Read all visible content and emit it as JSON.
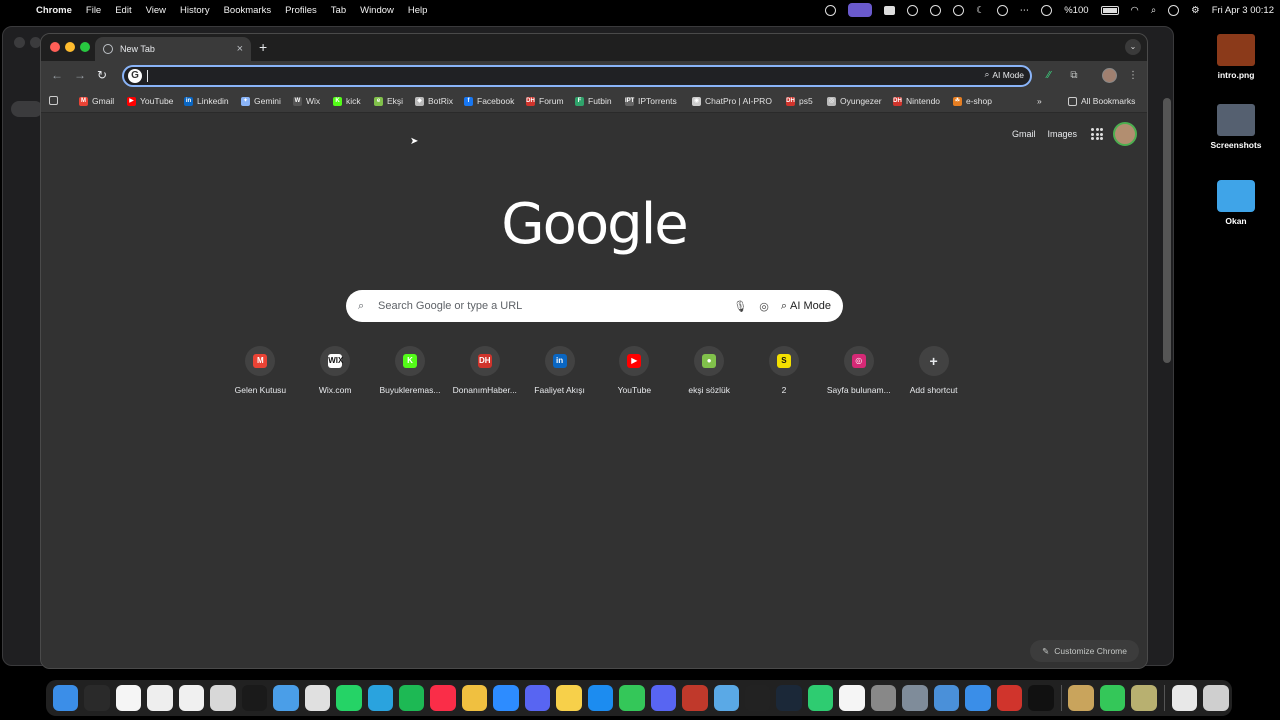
{
  "menubar": {
    "app_name": "Chrome",
    "menus": [
      "File",
      "Edit",
      "View",
      "History",
      "Bookmarks",
      "Profiles",
      "Tab",
      "Window",
      "Help"
    ],
    "battery": "%100",
    "datetime": "Fri Apr 3  00:12"
  },
  "desktop": {
    "items": [
      {
        "label": "intro.png",
        "color": "#8b3a1a"
      },
      {
        "label": "Screenshots",
        "color": "#556070"
      },
      {
        "label": "Okan",
        "color": "#3fa4e8"
      }
    ]
  },
  "browser": {
    "tab": {
      "title": "New Tab",
      "close": "×"
    },
    "new_tab_symbol": "+",
    "omnibox": {
      "value": "",
      "ai_label": "AI Mode"
    },
    "bookmarks": [
      {
        "label": "Gmail",
        "color": "#ea4335",
        "glyph": "M"
      },
      {
        "label": "YouTube",
        "color": "#ff0000",
        "glyph": "▶"
      },
      {
        "label": "Linkedin",
        "color": "#0a66c2",
        "glyph": "in"
      },
      {
        "label": "Gemini",
        "color": "#8ab4f8",
        "glyph": "✦"
      },
      {
        "label": "Wix",
        "color": "#555555",
        "glyph": "W"
      },
      {
        "label": "kick",
        "color": "#53fc18",
        "glyph": "K"
      },
      {
        "label": "Ekşi",
        "color": "#81c14b",
        "glyph": "e"
      },
      {
        "label": "BotRix",
        "color": "#bbbbbb",
        "glyph": "◆"
      },
      {
        "label": "Facebook",
        "color": "#1877f2",
        "glyph": "f"
      },
      {
        "label": "Forum",
        "color": "#d0342c",
        "glyph": "DH"
      },
      {
        "label": "Futbin",
        "color": "#2fa36b",
        "glyph": "F"
      },
      {
        "label": "IPTorrents",
        "color": "#666666",
        "glyph": "IPT"
      },
      {
        "label": "ChatPro | AI-PRO",
        "color": "#cccccc",
        "glyph": "◉"
      },
      {
        "label": "ps5",
        "color": "#d0342c",
        "glyph": "DH"
      },
      {
        "label": "Oyungezer",
        "color": "#bbbbbb",
        "glyph": "◎"
      },
      {
        "label": "Nintendo",
        "color": "#d0342c",
        "glyph": "DH"
      },
      {
        "label": "e-shop",
        "color": "#e67e22",
        "glyph": "☘"
      }
    ],
    "bookmarks_overflow": "»",
    "all_bookmarks": "All Bookmarks"
  },
  "newtab": {
    "top_links": {
      "gmail": "Gmail",
      "images": "Images"
    },
    "logo": "Google",
    "search": {
      "placeholder": "Search Google or type a URL",
      "ai_label": "AI Mode"
    },
    "shortcuts": [
      {
        "label": "Gelen Kutusu",
        "glyph": "M",
        "color": "#ea4335"
      },
      {
        "label": "Wix.com",
        "glyph": "WIX",
        "color": "#ffffff"
      },
      {
        "label": "Buyukleremas...",
        "glyph": "K",
        "color": "#53fc18"
      },
      {
        "label": "DonanımHaber...",
        "glyph": "DH",
        "color": "#d0342c"
      },
      {
        "label": "Faaliyet Akışı",
        "glyph": "in",
        "color": "#0a66c2"
      },
      {
        "label": "YouTube",
        "glyph": "▶",
        "color": "#ff0000"
      },
      {
        "label": "ekşi sözlük",
        "glyph": "●",
        "color": "#81c14b"
      },
      {
        "label": "2",
        "glyph": "S",
        "color": "#f4e000"
      },
      {
        "label": "Sayfa bulunam...",
        "glyph": "◎",
        "color": "#d62976"
      },
      {
        "label": "Add shortcut",
        "glyph": "+",
        "color": "#424242"
      }
    ],
    "customize": "Customize Chrome"
  },
  "dock": {
    "apps": [
      {
        "name": "finder",
        "color": "#3b8ee8"
      },
      {
        "name": "activity",
        "color": "#2a2a2a"
      },
      {
        "name": "yandex",
        "color": "#f5f5f5"
      },
      {
        "name": "yandex-alt",
        "color": "#eeeeee"
      },
      {
        "name": "text-app",
        "color": "#f0f0f0"
      },
      {
        "name": "launchpad",
        "color": "#d8d8d8"
      },
      {
        "name": "chatgpt",
        "color": "#1a1a1a"
      },
      {
        "name": "safari",
        "color": "#4a9ee8"
      },
      {
        "name": "chrome",
        "color": "#e0e0e0"
      },
      {
        "name": "whatsapp",
        "color": "#25d366"
      },
      {
        "name": "telegram",
        "color": "#2aa3de"
      },
      {
        "name": "spotify",
        "color": "#1db954"
      },
      {
        "name": "music",
        "color": "#fa2d48"
      },
      {
        "name": "photos",
        "color": "#f0c040"
      },
      {
        "name": "zoom",
        "color": "#2d8cff"
      },
      {
        "name": "arc",
        "color": "#5865f2"
      },
      {
        "name": "notes",
        "color": "#f7d04a"
      },
      {
        "name": "app-store",
        "color": "#1c8cf0"
      },
      {
        "name": "messages",
        "color": "#34c759"
      },
      {
        "name": "discord",
        "color": "#5865f2"
      },
      {
        "name": "dashboard",
        "color": "#c0392b"
      },
      {
        "name": "maps",
        "color": "#5aa9e6"
      },
      {
        "name": "github",
        "color": "#222222"
      },
      {
        "name": "steam",
        "color": "#1b2838"
      },
      {
        "name": "facetime",
        "color": "#2ecc71"
      },
      {
        "name": "calendar",
        "color": "#f5f5f5"
      },
      {
        "name": "settings",
        "color": "#888888"
      },
      {
        "name": "system-prefs",
        "color": "#7f8c9a"
      },
      {
        "name": "clipboard",
        "color": "#4a90d9"
      },
      {
        "name": "vpn",
        "color": "#3a8ee8"
      },
      {
        "name": "red-app",
        "color": "#d0342c"
      },
      {
        "name": "capcut",
        "color": "#111111"
      }
    ],
    "recents": [
      {
        "name": "lol",
        "color": "#c9a45c"
      },
      {
        "name": "phone",
        "color": "#34c759"
      },
      {
        "name": "game",
        "color": "#b8b070"
      }
    ],
    "trailing": [
      {
        "name": "document",
        "color": "#e8e8e8"
      },
      {
        "name": "trash",
        "color": "#cfcfcf"
      }
    ]
  }
}
